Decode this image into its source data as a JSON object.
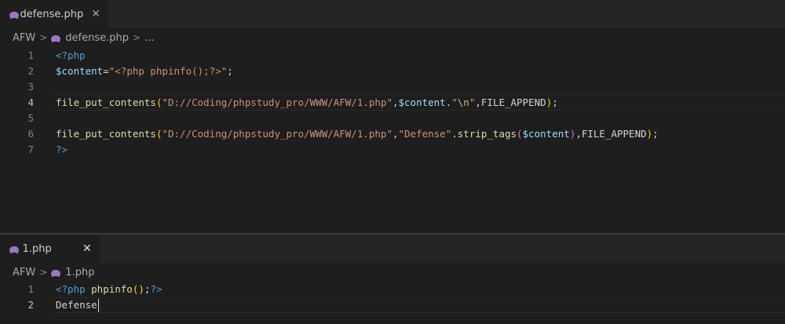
{
  "top_pane": {
    "tab": {
      "label": "defense.php",
      "close": "✕",
      "icon": "php-elephant-icon"
    },
    "breadcrumb": {
      "folder": "AFW",
      "sep": ">",
      "file": "defense.php",
      "more": "..."
    },
    "lines": [
      {
        "number": "1",
        "tokens": [
          {
            "cls": "t-tag",
            "text": "<?php"
          }
        ]
      },
      {
        "number": "2",
        "tokens": [
          {
            "cls": "t-var",
            "text": "$content"
          },
          {
            "cls": "t-plain",
            "text": "="
          },
          {
            "cls": "t-str",
            "text": "\"<?php phpinfo();?>\""
          },
          {
            "cls": "t-plain",
            "text": ";"
          }
        ]
      },
      {
        "number": "3",
        "tokens": []
      },
      {
        "number": "4",
        "current": true,
        "tokens": [
          {
            "cls": "t-fn",
            "text": "file_put_contents"
          },
          {
            "cls": "t-brace",
            "text": "("
          },
          {
            "cls": "t-str",
            "text": "\"D://Coding/phpstudy_pro/WWW/AFW/1.php\""
          },
          {
            "cls": "t-plain",
            "text": ","
          },
          {
            "cls": "t-var",
            "text": "$content"
          },
          {
            "cls": "t-plain",
            "text": "."
          },
          {
            "cls": "t-str",
            "text": "\""
          },
          {
            "cls": "t-esc",
            "text": "\\n"
          },
          {
            "cls": "t-str",
            "text": "\""
          },
          {
            "cls": "t-plain",
            "text": ",FILE_APPEND"
          },
          {
            "cls": "t-brace",
            "text": ")"
          },
          {
            "cls": "t-plain",
            "text": ";"
          }
        ]
      },
      {
        "number": "5",
        "tokens": []
      },
      {
        "number": "6",
        "tokens": [
          {
            "cls": "t-fn",
            "text": "file_put_contents"
          },
          {
            "cls": "t-brace",
            "text": "("
          },
          {
            "cls": "t-str",
            "text": "\"D://Coding/phpstudy_pro/WWW/AFW/1.php\""
          },
          {
            "cls": "t-plain",
            "text": ","
          },
          {
            "cls": "t-str",
            "text": "\"Defense\""
          },
          {
            "cls": "t-plain",
            "text": "."
          },
          {
            "cls": "t-fn",
            "text": "strip_tags"
          },
          {
            "cls": "t-brace2",
            "text": "("
          },
          {
            "cls": "t-var",
            "text": "$content"
          },
          {
            "cls": "t-brace2",
            "text": ")"
          },
          {
            "cls": "t-plain",
            "text": ",FILE_APPEND"
          },
          {
            "cls": "t-brace",
            "text": ")"
          },
          {
            "cls": "t-plain",
            "text": ";"
          }
        ]
      },
      {
        "number": "7",
        "tokens": [
          {
            "cls": "t-tag",
            "text": "?>"
          }
        ]
      }
    ]
  },
  "bottom_pane": {
    "tab": {
      "label": "1.php",
      "close": "✕",
      "icon": "php-elephant-icon"
    },
    "breadcrumb": {
      "folder": "AFW",
      "sep": ">",
      "file": "1.php"
    },
    "lines": [
      {
        "number": "1",
        "tokens": [
          {
            "cls": "t-tag",
            "text": "<?php "
          },
          {
            "cls": "t-fn",
            "text": "phpinfo"
          },
          {
            "cls": "t-brace",
            "text": "()"
          },
          {
            "cls": "t-plain",
            "text": ";"
          },
          {
            "cls": "t-tag",
            "text": "?>"
          }
        ]
      },
      {
        "number": "2",
        "current": true,
        "cursor": true,
        "tokens": [
          {
            "cls": "t-plain",
            "text": "Defense"
          }
        ]
      }
    ]
  },
  "colors": {
    "background": "#1e1e1e",
    "tabbar": "#252526",
    "keyword_tag": "#569cd6",
    "variable": "#9cdcfe",
    "string": "#ce9178",
    "function": "#dcdcaa",
    "bracket_1": "#ffd700",
    "bracket_2": "#da70d6",
    "php_icon": "#a074c4"
  }
}
